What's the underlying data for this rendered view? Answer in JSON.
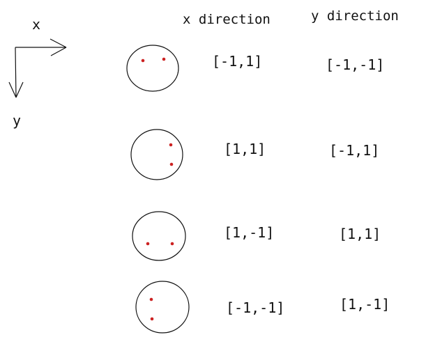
{
  "axes": {
    "x_label": "x",
    "y_label": "y"
  },
  "headers": {
    "x_direction": "x direction",
    "y_direction": "y direction"
  },
  "rows": [
    {
      "dots": "two dots side by side near top",
      "x_direction": "[-1,1]",
      "y_direction": "[-1,-1]"
    },
    {
      "dots": "two dots stacked on right side",
      "x_direction": "[1,1]",
      "y_direction": "[-1,1]"
    },
    {
      "dots": "two dots side by side near bottom",
      "x_direction": "[1,-1]",
      "y_direction": "[1,1]"
    },
    {
      "dots": "two dots stacked on left side",
      "x_direction": "[-1,-1]",
      "y_direction": "[1,-1]"
    }
  ],
  "colors": {
    "ink": "#111111",
    "dot": "#cc2222"
  }
}
